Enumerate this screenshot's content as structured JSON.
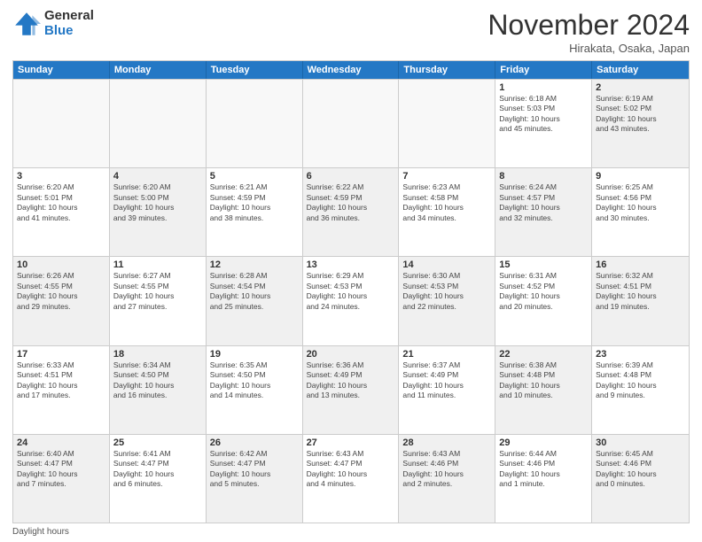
{
  "header": {
    "logo_general": "General",
    "logo_blue": "Blue",
    "month_title": "November 2024",
    "location": "Hirakata, Osaka, Japan"
  },
  "days_of_week": [
    "Sunday",
    "Monday",
    "Tuesday",
    "Wednesday",
    "Thursday",
    "Friday",
    "Saturday"
  ],
  "weeks": [
    [
      {
        "day": "",
        "info": "",
        "empty": true
      },
      {
        "day": "",
        "info": "",
        "empty": true
      },
      {
        "day": "",
        "info": "",
        "empty": true
      },
      {
        "day": "",
        "info": "",
        "empty": true
      },
      {
        "day": "",
        "info": "",
        "empty": true
      },
      {
        "day": "1",
        "info": "Sunrise: 6:18 AM\nSunset: 5:03 PM\nDaylight: 10 hours\nand 45 minutes."
      },
      {
        "day": "2",
        "info": "Sunrise: 6:19 AM\nSunset: 5:02 PM\nDaylight: 10 hours\nand 43 minutes.",
        "shaded": true
      }
    ],
    [
      {
        "day": "3",
        "info": "Sunrise: 6:20 AM\nSunset: 5:01 PM\nDaylight: 10 hours\nand 41 minutes."
      },
      {
        "day": "4",
        "info": "Sunrise: 6:20 AM\nSunset: 5:00 PM\nDaylight: 10 hours\nand 39 minutes.",
        "shaded": true
      },
      {
        "day": "5",
        "info": "Sunrise: 6:21 AM\nSunset: 4:59 PM\nDaylight: 10 hours\nand 38 minutes."
      },
      {
        "day": "6",
        "info": "Sunrise: 6:22 AM\nSunset: 4:59 PM\nDaylight: 10 hours\nand 36 minutes.",
        "shaded": true
      },
      {
        "day": "7",
        "info": "Sunrise: 6:23 AM\nSunset: 4:58 PM\nDaylight: 10 hours\nand 34 minutes."
      },
      {
        "day": "8",
        "info": "Sunrise: 6:24 AM\nSunset: 4:57 PM\nDaylight: 10 hours\nand 32 minutes.",
        "shaded": true
      },
      {
        "day": "9",
        "info": "Sunrise: 6:25 AM\nSunset: 4:56 PM\nDaylight: 10 hours\nand 30 minutes."
      }
    ],
    [
      {
        "day": "10",
        "info": "Sunrise: 6:26 AM\nSunset: 4:55 PM\nDaylight: 10 hours\nand 29 minutes.",
        "shaded": true
      },
      {
        "day": "11",
        "info": "Sunrise: 6:27 AM\nSunset: 4:55 PM\nDaylight: 10 hours\nand 27 minutes."
      },
      {
        "day": "12",
        "info": "Sunrise: 6:28 AM\nSunset: 4:54 PM\nDaylight: 10 hours\nand 25 minutes.",
        "shaded": true
      },
      {
        "day": "13",
        "info": "Sunrise: 6:29 AM\nSunset: 4:53 PM\nDaylight: 10 hours\nand 24 minutes."
      },
      {
        "day": "14",
        "info": "Sunrise: 6:30 AM\nSunset: 4:53 PM\nDaylight: 10 hours\nand 22 minutes.",
        "shaded": true
      },
      {
        "day": "15",
        "info": "Sunrise: 6:31 AM\nSunset: 4:52 PM\nDaylight: 10 hours\nand 20 minutes."
      },
      {
        "day": "16",
        "info": "Sunrise: 6:32 AM\nSunset: 4:51 PM\nDaylight: 10 hours\nand 19 minutes.",
        "shaded": true
      }
    ],
    [
      {
        "day": "17",
        "info": "Sunrise: 6:33 AM\nSunset: 4:51 PM\nDaylight: 10 hours\nand 17 minutes."
      },
      {
        "day": "18",
        "info": "Sunrise: 6:34 AM\nSunset: 4:50 PM\nDaylight: 10 hours\nand 16 minutes.",
        "shaded": true
      },
      {
        "day": "19",
        "info": "Sunrise: 6:35 AM\nSunset: 4:50 PM\nDaylight: 10 hours\nand 14 minutes."
      },
      {
        "day": "20",
        "info": "Sunrise: 6:36 AM\nSunset: 4:49 PM\nDaylight: 10 hours\nand 13 minutes.",
        "shaded": true
      },
      {
        "day": "21",
        "info": "Sunrise: 6:37 AM\nSunset: 4:49 PM\nDaylight: 10 hours\nand 11 minutes."
      },
      {
        "day": "22",
        "info": "Sunrise: 6:38 AM\nSunset: 4:48 PM\nDaylight: 10 hours\nand 10 minutes.",
        "shaded": true
      },
      {
        "day": "23",
        "info": "Sunrise: 6:39 AM\nSunset: 4:48 PM\nDaylight: 10 hours\nand 9 minutes."
      }
    ],
    [
      {
        "day": "24",
        "info": "Sunrise: 6:40 AM\nSunset: 4:47 PM\nDaylight: 10 hours\nand 7 minutes.",
        "shaded": true
      },
      {
        "day": "25",
        "info": "Sunrise: 6:41 AM\nSunset: 4:47 PM\nDaylight: 10 hours\nand 6 minutes."
      },
      {
        "day": "26",
        "info": "Sunrise: 6:42 AM\nSunset: 4:47 PM\nDaylight: 10 hours\nand 5 minutes.",
        "shaded": true
      },
      {
        "day": "27",
        "info": "Sunrise: 6:43 AM\nSunset: 4:47 PM\nDaylight: 10 hours\nand 4 minutes."
      },
      {
        "day": "28",
        "info": "Sunrise: 6:43 AM\nSunset: 4:46 PM\nDaylight: 10 hours\nand 2 minutes.",
        "shaded": true
      },
      {
        "day": "29",
        "info": "Sunrise: 6:44 AM\nSunset: 4:46 PM\nDaylight: 10 hours\nand 1 minute."
      },
      {
        "day": "30",
        "info": "Sunrise: 6:45 AM\nSunset: 4:46 PM\nDaylight: 10 hours\nand 0 minutes.",
        "shaded": true
      }
    ]
  ],
  "footer": {
    "daylight_label": "Daylight hours"
  }
}
